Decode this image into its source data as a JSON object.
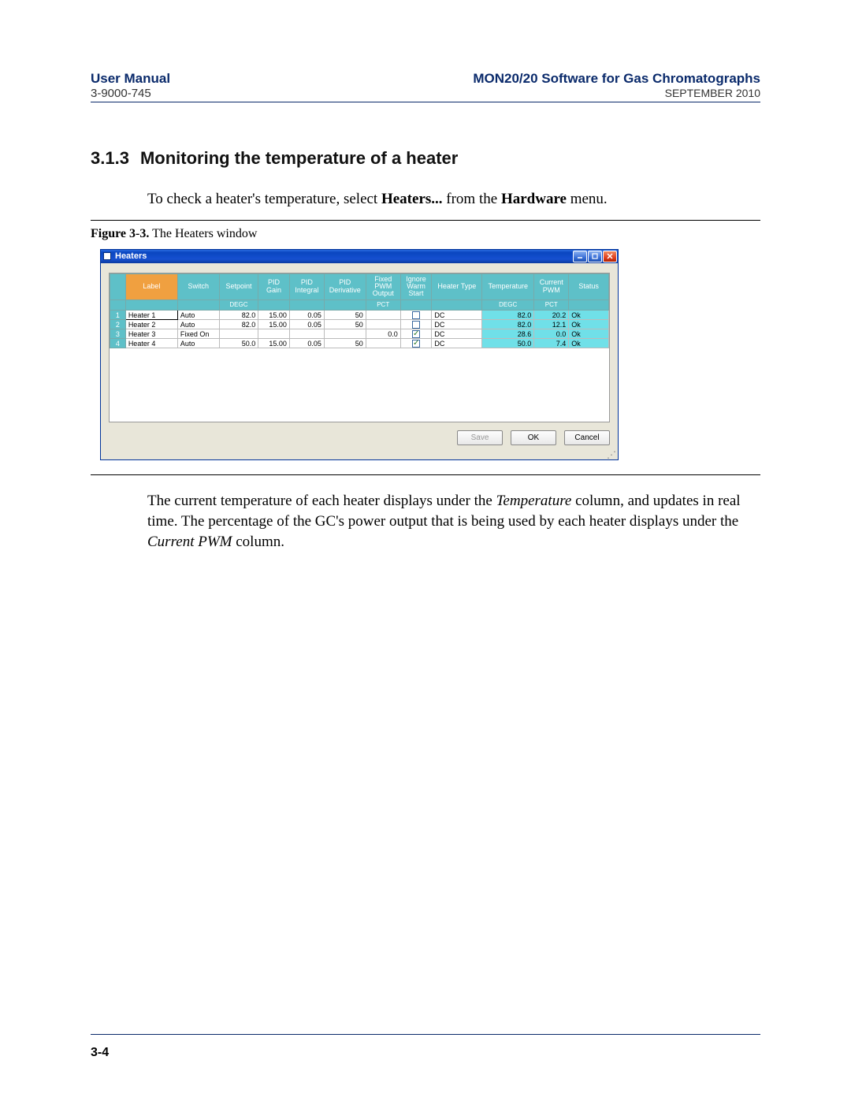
{
  "header": {
    "left_title": "User Manual",
    "doc_number": "3-9000-745",
    "right_title": "MON20/20 Software for Gas Chromatographs",
    "date": "SEPTEMBER 2010"
  },
  "section": {
    "number": "3.1.3",
    "title": "Monitoring the temperature of a heater"
  },
  "intro": {
    "pre": "To check a heater's temperature, select ",
    "bold1": "Heaters...",
    "mid": " from the ",
    "bold2": "Hardware",
    "post": " menu."
  },
  "figure": {
    "label": "Figure 3-3.",
    "caption": "The Heaters window"
  },
  "window": {
    "title": "Heaters",
    "buttons": {
      "save": "Save",
      "ok": "OK",
      "cancel": "Cancel"
    },
    "columns": [
      "",
      "Label",
      "Switch",
      "Setpoint",
      "PID Gain",
      "PID Integral",
      "PID Derivative",
      "Fixed PWM Output",
      "Ignore Warm Start",
      "Heater Type",
      "Temperature",
      "Current PWM",
      "Status"
    ],
    "units": [
      "",
      "",
      "",
      "DEGC",
      "",
      "",
      "",
      "PCT",
      "",
      "",
      "DEGC",
      "PCT",
      ""
    ],
    "rows": [
      {
        "n": "1",
        "label": "Heater 1",
        "switch": "Auto",
        "setpoint": "82.0",
        "gain": "15.00",
        "integral": "0.05",
        "deriv": "50",
        "fixed": "",
        "ignore": false,
        "type": "DC",
        "temp": "82.0",
        "pwm": "20.2",
        "status": "Ok"
      },
      {
        "n": "2",
        "label": "Heater 2",
        "switch": "Auto",
        "setpoint": "82.0",
        "gain": "15.00",
        "integral": "0.05",
        "deriv": "50",
        "fixed": "",
        "ignore": false,
        "type": "DC",
        "temp": "82.0",
        "pwm": "12.1",
        "status": "Ok"
      },
      {
        "n": "3",
        "label": "Heater 3",
        "switch": "Fixed On",
        "setpoint": "",
        "gain": "",
        "integral": "",
        "deriv": "",
        "fixed": "0.0",
        "ignore": true,
        "type": "DC",
        "temp": "28.6",
        "pwm": "0.0",
        "status": "Ok"
      },
      {
        "n": "4",
        "label": "Heater 4",
        "switch": "Auto",
        "setpoint": "50.0",
        "gain": "15.00",
        "integral": "0.05",
        "deriv": "50",
        "fixed": "",
        "ignore": true,
        "type": "DC",
        "temp": "50.0",
        "pwm": "7.4",
        "status": "Ok"
      }
    ]
  },
  "para2": {
    "t1": "The current temperature of each heater displays under the ",
    "i1": "Temperature",
    "t2": " column, and updates in real time.  The percentage of the GC's power output that is being used by each heater displays under the ",
    "i2": "Current PWM",
    "t3": " column."
  },
  "pagenum": "3-4"
}
